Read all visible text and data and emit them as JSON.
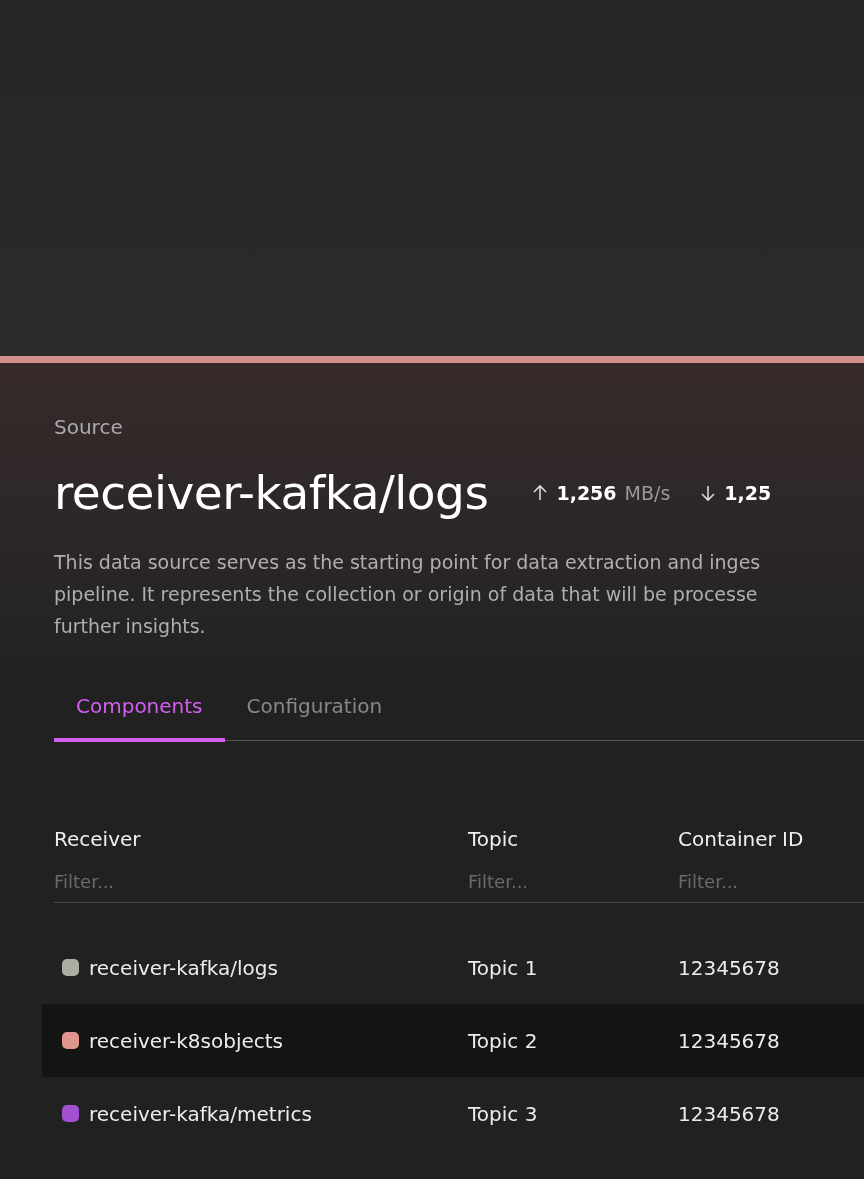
{
  "panel": {
    "label": "Source",
    "title": "receiver-kafka/logs",
    "stats": [
      {
        "kind": "upload",
        "value": "1,256",
        "unit": "MB/s"
      },
      {
        "kind": "download",
        "value": "1,25"
      }
    ],
    "description_lines": [
      "This data source serves as the starting point for data extraction and inges",
      "pipeline. It represents the collection or origin of data that will be processe",
      "further insights."
    ]
  },
  "tabs": [
    {
      "label": "Components",
      "selected": true
    },
    {
      "label": "Configuration",
      "selected": false
    }
  ],
  "table": {
    "columns": [
      {
        "heading": "Receiver",
        "placeholder": "Filter..."
      },
      {
        "heading": "Topic",
        "placeholder": "Filter..."
      },
      {
        "heading": "Container ID",
        "placeholder": "Filter..."
      }
    ],
    "rows": [
      {
        "receiver": "receiver-kafka/logs",
        "color": "#a9ada4",
        "topic": "Topic 1",
        "container_id": "12345678",
        "selected": false
      },
      {
        "receiver": "receiver-k8sobjects",
        "color": "#e0958f",
        "topic": "Topic 2",
        "container_id": "12345678",
        "selected": true
      },
      {
        "receiver": "receiver-kafka/metrics",
        "color": "#a24fd0",
        "topic": "Topic 3",
        "container_id": "12345678",
        "selected": false
      }
    ]
  }
}
